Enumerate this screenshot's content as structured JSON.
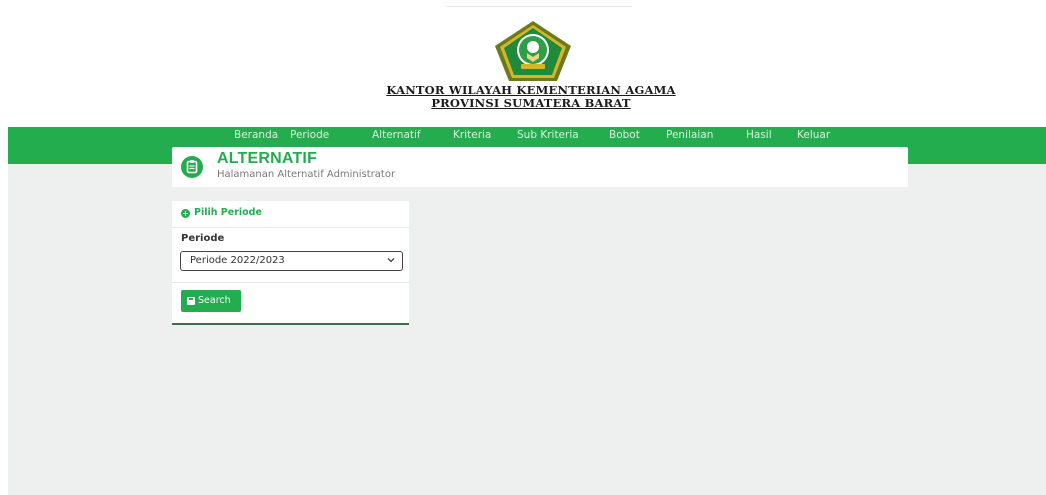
{
  "header": {
    "org_line1": "KANTOR WILAYAH KEMENTERIAN AGAMA",
    "org_line2": "PROVINSI SUMATERA BARAT",
    "logo_icon": "kemenag-logo-icon",
    "logo_colors": {
      "pentagon": "#6b7a1e",
      "inner": "#1f8a3a",
      "gold": "#d6b52b"
    }
  },
  "nav": {
    "items": [
      {
        "label": "Beranda"
      },
      {
        "label": "Periode"
      },
      {
        "label": "Alternatif"
      },
      {
        "label": "Kriteria"
      },
      {
        "label": "Sub Kriteria"
      },
      {
        "label": "Bobot"
      },
      {
        "label": "Penilaian"
      },
      {
        "label": "Hasil"
      },
      {
        "label": "Keluar"
      }
    ]
  },
  "page": {
    "title": "ALTERNATIF",
    "subtitle": "Halamanan Alternatif Administrator",
    "title_icon": "clipboard-icon"
  },
  "form": {
    "header_label": "Pilih Periode",
    "header_icon": "plus-circle-icon",
    "field_label": "Periode",
    "select_value": "Periode 2022/2023",
    "select_icon": "chevron-down-icon",
    "button_label": "Search",
    "button_icon": "save-icon"
  },
  "colors": {
    "accent": "#23ad4f",
    "content_bg": "#edf0ef",
    "nav_text": "#d8f2df",
    "form_border": "#3a6e48"
  }
}
